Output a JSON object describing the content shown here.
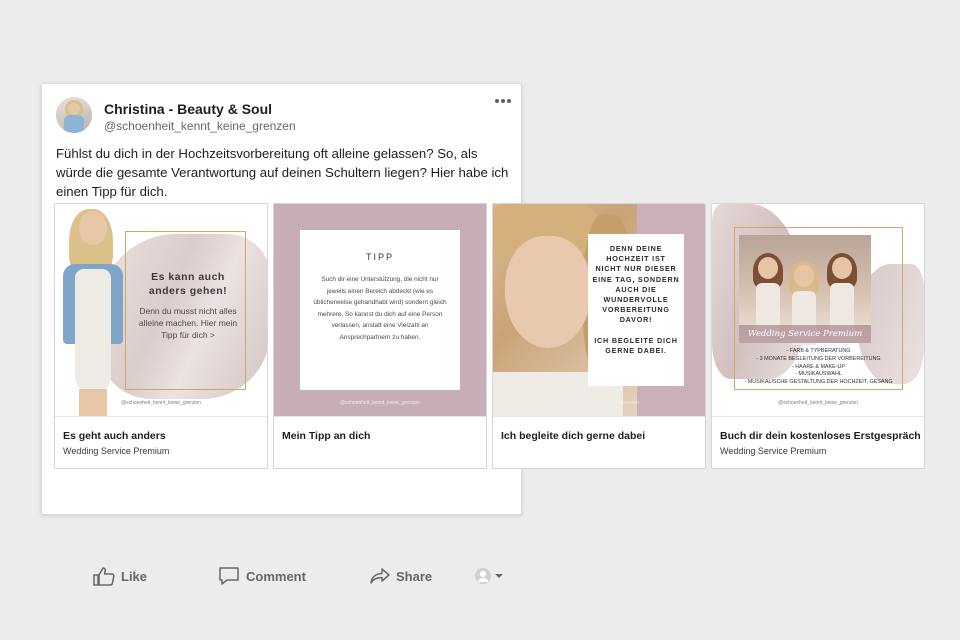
{
  "post": {
    "author_name": "Christina - Beauty & Soul",
    "author_handle": "@schoenheit_kennt_keine_grenzen",
    "text": "Fühlst du dich in der Hochzeitsvorbereitung oft alleine gelassen? So, als würde die gesamte Verantwortung auf deinen Schultern liegen?  Hier habe ich einen Tipp für dich."
  },
  "carousel": [
    {
      "title": "Es geht auch anders",
      "subtitle": "Wedding Service Premium",
      "image_heading": "Es kann auch anders gehen!",
      "image_body": "Denn du musst nicht alles alleine machen. Hier mein Tipp für dich >",
      "image_handle": "@schoenheit_kennt_keine_grenzen"
    },
    {
      "title": "Mein Tipp an dich",
      "subtitle": "",
      "image_heading": "TIPP",
      "image_body": "Such dir eine Unterstützung, die nicht nur jeweils einen Bereich abdeckt (wie es üblicherweise gehandhabt wird) sondern gleich mehrere. So kannst du dich auf eine Person verlassen, anstatt eine Vielzahl an Ansprechpartnern zu haben.",
      "image_handle": "@schoenheit_kennt_keine_grenzen"
    },
    {
      "title": "Ich begleite dich gerne dabei",
      "subtitle": "",
      "image_body": "DENN DEINE HOCHZEIT IST NICHT NUR DIESER EINE TAG, SONDERN AUCH DIE WUNDERVOLLE VORBEREITUNG DAVOR!\n\nICH BEGLEITE DICH GERNE DABEI.",
      "image_handle": "@schoenheit_kennt_keine_grenzen"
    },
    {
      "title": "Buch dir dein kostenloses Erstgespräch",
      "subtitle": "Wedding Service Premium",
      "image_script": "Wedding Service Premium",
      "image_list": "- Farb & Typberatung\n- 3 Monate Begleitung der Vorbereitung\n- Haare & Make-up\n- Musikauswahl\n- Musikalische Gestaltung der Hochzeit, Gesang",
      "image_handle": "@schoenheit_kennt_keine_grenzen"
    }
  ],
  "actions": {
    "like": "Like",
    "comment": "Comment",
    "share": "Share"
  },
  "icons": {
    "more": "more-options-icon",
    "like": "thumbs-up-icon",
    "comment": "comment-bubble-icon",
    "share": "share-arrow-icon",
    "audience": "audience-selector-icon"
  },
  "colors": {
    "mauve": "#c7adb8",
    "gold_frame": "#cfa963",
    "action_text": "#65676b"
  }
}
